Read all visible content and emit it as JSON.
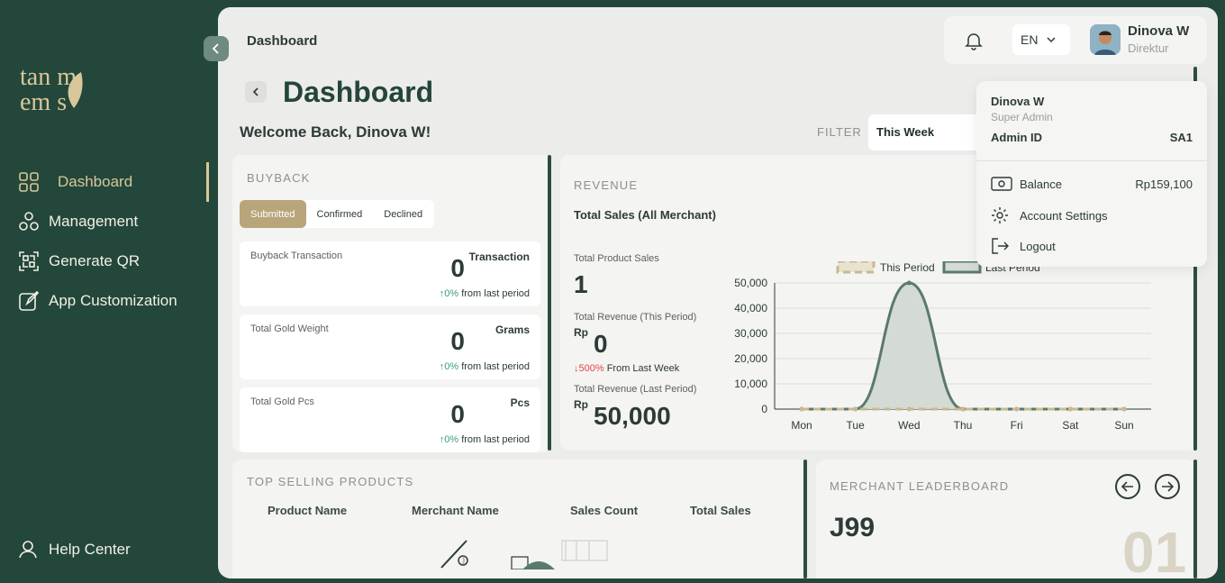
{
  "sidebar": {
    "logo": {
      "line1": "tan m",
      "line2": "em s"
    },
    "items": [
      {
        "label": "Dashboard",
        "icon": "grid-icon"
      },
      {
        "label": "Management",
        "icon": "nodes-icon"
      },
      {
        "label": "Generate QR",
        "icon": "qr-icon"
      },
      {
        "label": "App Customization",
        "icon": "edit-icon"
      }
    ],
    "help": "Help Center"
  },
  "header": {
    "breadcrumb": "Dashboard",
    "lang": "EN",
    "user_name": "Dinova W",
    "user_role": "Direktur"
  },
  "page": {
    "title": "Dashboard",
    "welcome": "Welcome Back, Dinova W!",
    "filter_label": "FILTER",
    "filter_value": "This Week"
  },
  "buyback": {
    "title": "BUYBACK",
    "tabs": [
      "Submitted",
      "Confirmed",
      "Declined"
    ],
    "cards": [
      {
        "label": "Buyback Transaction",
        "value": "0",
        "unit": "Transaction",
        "pct": "0%",
        "suffix": "from last period"
      },
      {
        "label": "Total Gold Weight",
        "value": "0",
        "unit": "Grams",
        "pct": "0%",
        "suffix": "from last period"
      },
      {
        "label": "Total Gold Pcs",
        "value": "0",
        "unit": "Pcs",
        "pct": "0%",
        "suffix": "from last period"
      }
    ]
  },
  "revenue": {
    "title": "REVENUE",
    "subtitle": "Total Sales (All Merchant)",
    "product_sales_label": "Total Product Sales",
    "product_sales_value": "1",
    "rev_this_label": "Total Revenue (This Period)",
    "rev_this_currency": "Rp",
    "rev_this_value": "0",
    "change_pct": "500%",
    "change_suffix": "From Last Week",
    "rev_last_label": "Total Revenue (Last Period)",
    "rev_last_currency": "Rp",
    "rev_last_value": "50,000"
  },
  "chart_data": {
    "type": "area",
    "categories": [
      "Mon",
      "Tue",
      "Wed",
      "Thu",
      "Fri",
      "Sat",
      "Sun"
    ],
    "series": [
      {
        "name": "This Period",
        "values": [
          0,
          0,
          0,
          0,
          0,
          0,
          0
        ],
        "color": "#c8b990"
      },
      {
        "name": "Last Period",
        "values": [
          0,
          0,
          50000,
          0,
          0,
          0,
          0
        ],
        "color": "#5a7a6c"
      }
    ],
    "yticks": [
      "0",
      "10,000",
      "20,000",
      "30,000",
      "40,000",
      "50,000"
    ],
    "ylim": [
      0,
      50000
    ],
    "legend": "top"
  },
  "top_selling": {
    "title": "TOP SELLING PRODUCTS",
    "columns": [
      "Product Name",
      "Merchant Name",
      "Sales Count",
      "Total Sales"
    ]
  },
  "leaderboard": {
    "title": "MERCHANT LEADERBOARD",
    "merchant": "J99",
    "rank": "01"
  },
  "dropdown": {
    "name": "Dinova W",
    "role": "Super Admin",
    "admin_id_label": "Admin ID",
    "admin_id": "SA1",
    "balance_label": "Balance",
    "balance_value": "Rp159,100",
    "settings_label": "Account Settings",
    "logout_label": "Logout"
  },
  "colors": {
    "brand": "#23473a",
    "accent": "#b8a57a",
    "up": "#3aa06f",
    "down": "#e04848"
  }
}
